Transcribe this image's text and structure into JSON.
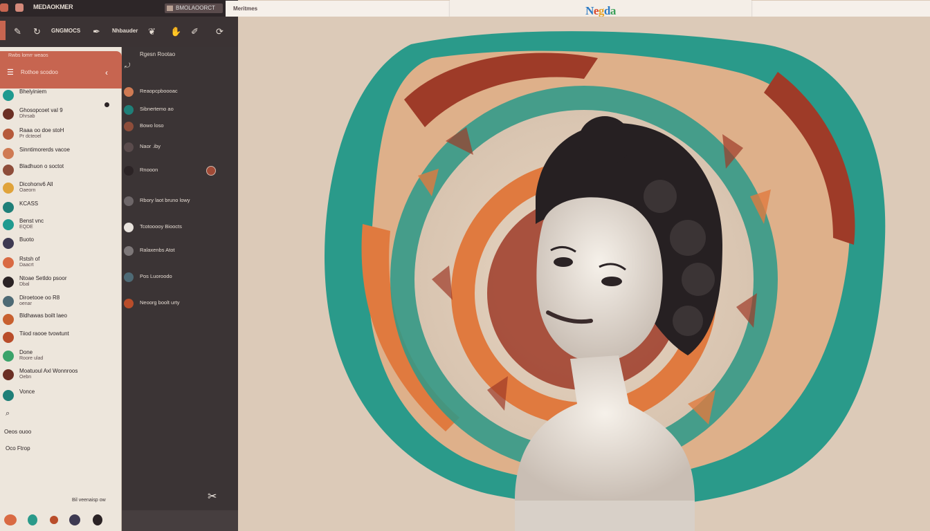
{
  "window": {
    "title": "MEDAOKMER",
    "doc_tab": "BMOLAOORCT",
    "address": "Meritmes",
    "logo_letters": [
      "N",
      "e",
      "g",
      "d",
      "a"
    ]
  },
  "toolbar": {
    "label_one": "GNGMOCS",
    "label_two": "Nhbauder"
  },
  "sidebar": {
    "header_sub": "Rwbs lomrr weaos",
    "header_name": "Rothoe scodoo",
    "items": [
      {
        "l1": "Bhelyiniem",
        "l2": "",
        "avatar": "#1f9a8f"
      },
      {
        "l1": "Ghosopcoet vaI 9",
        "l2": "Dhrsab",
        "avatar": "#6b2f24"
      },
      {
        "l1": "Raaa oo doe stoH",
        "l2": "Pr dcteoel",
        "avatar": "#b65a3b"
      },
      {
        "l1": "Sinntimorerds vacoe",
        "l2": "",
        "avatar": "#cf7a53"
      },
      {
        "l1": "Bladhuon o soctot",
        "l2": "",
        "avatar": "#8e4d3a"
      },
      {
        "l1": "Dicohonv6 All",
        "l2": "Oaeorn",
        "avatar": "#e0a33a"
      },
      {
        "l1": "KCASS",
        "l2": "",
        "avatar": "#1f7f78"
      },
      {
        "l1": "Benst vnc",
        "l2": "EQDE",
        "avatar": "#1f9a8f"
      },
      {
        "l1": "Buoto",
        "l2": "",
        "avatar": "#3e3a52"
      },
      {
        "l1": "Rstsh of",
        "l2": "Daacrt",
        "avatar": "#d96a43"
      },
      {
        "l1": "Ntoae Setldo psoor",
        "l2": "Dbal",
        "avatar": "#2b2325"
      },
      {
        "l1": "Diroetooe oo R8",
        "l2": "oenar",
        "avatar": "#4e6a75"
      },
      {
        "l1": "Bldhawas boilt laeo",
        "l2": "",
        "avatar": "#c8602f"
      },
      {
        "l1": "Tiiod raooe tvowtunt",
        "l2": "",
        "avatar": "#b94d2a"
      },
      {
        "l1": "Done",
        "l2": "Roore ulad",
        "avatar": "#3aa36a"
      },
      {
        "l1": "Moatuoul Axl Wonnroos",
        "l2": "Oebn",
        "avatar": "#6b2f24"
      },
      {
        "l1": "Vonce",
        "l2": "",
        "avatar": "#1f7f78"
      }
    ],
    "footer_a": "Oeos  ouoo",
    "footer_b": "Oco  Ftrop",
    "status": "Bil veenaisp  ow"
  },
  "middle": {
    "header": "Rgesn Rootao",
    "items": [
      {
        "t": "Reaopcpboooac",
        "avatar": "#cf7a53"
      },
      {
        "t": "Sibnertemo ao",
        "avatar": "#1f7f78"
      },
      {
        "t": "Bowo loso",
        "avatar": "#8e4d3a"
      },
      {
        "t": "Naor .iby",
        "avatar": "#5a4b4c"
      },
      {
        "t": "Rnooon",
        "avatar": "#2b2325"
      },
      {
        "t": "Rbory laot bruno lowy",
        "avatar": "#6d6668"
      },
      {
        "t": "Tcotooooy Bioocts",
        "avatar": "#e8e2dc"
      },
      {
        "t": "Ralaxenbs Atot",
        "avatar": "#7d7778"
      },
      {
        "t": "Pos Luoroodo",
        "avatar": "#4e6a75"
      },
      {
        "t": "Neoorg boolt urty",
        "avatar": "#b94d2a"
      }
    ]
  },
  "colors": {
    "teal": "#2a9a8a",
    "orange": "#e07a3f",
    "peach": "#f2b28a",
    "rust": "#9e3b28",
    "sidebar_header": "#c76550",
    "dark": "#3b3435"
  },
  "icons": [
    "app-icon",
    "brush-icon",
    "loop-icon",
    "pen-icon",
    "tools-icon",
    "back-icon",
    "menu-icon",
    "search-icon"
  ]
}
